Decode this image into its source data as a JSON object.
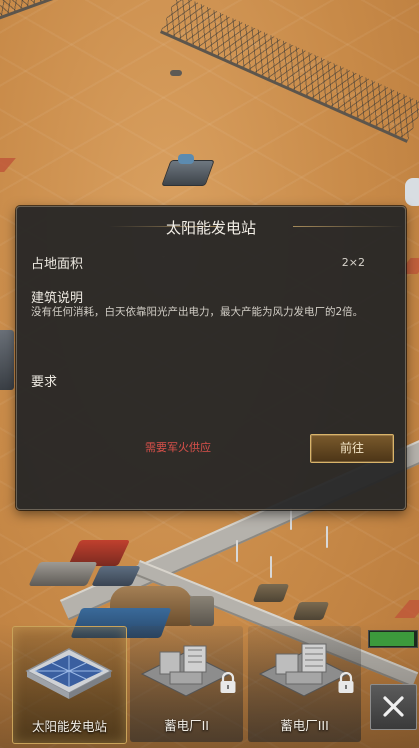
{
  "dialog": {
    "title": "太阳能发电站",
    "area_label": "占地面积",
    "area_value": "2×2",
    "desc_label": "建筑说明",
    "desc_text": "没有任何消耗，白天依靠阳光产出电力，最大产能为风力发电厂的2倍。",
    "requirement_label": "要求",
    "requirement_text": "需要军火供应",
    "go_button": "前往"
  },
  "building_bar": {
    "items": [
      {
        "label": "太阳能发电站",
        "selected": true,
        "locked": false
      },
      {
        "label": "蓄电厂II",
        "selected": false,
        "locked": true
      },
      {
        "label": "蓄电厂III",
        "selected": false,
        "locked": true
      }
    ],
    "resource_fill": 0.95,
    "close_icon": "close-icon"
  },
  "colors": {
    "accent_gold": "#c9a35a",
    "requirement_red": "#d8504a",
    "dialog_bg": "#262626"
  }
}
